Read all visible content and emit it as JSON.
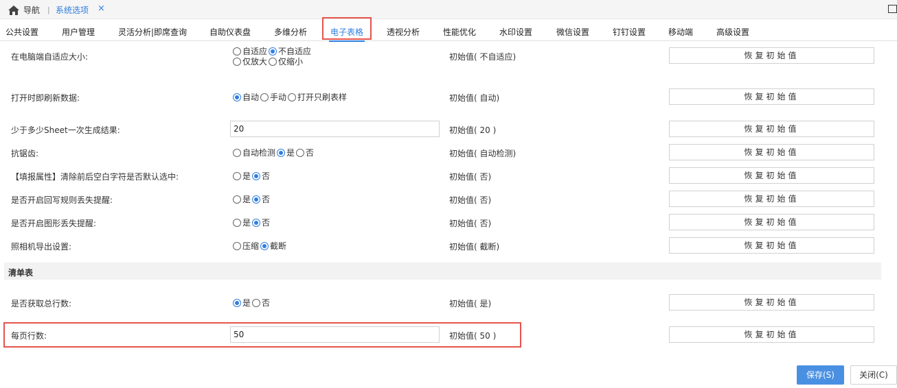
{
  "topbar": {
    "home_label": "导航",
    "separator": "|",
    "current_tab": "系统选项",
    "close_glyph": "×"
  },
  "tabs": [
    "公共设置",
    "用户管理",
    "灵活分析|即席查询",
    "自助仪表盘",
    "多维分析",
    "电子表格",
    "透视分析",
    "性能优化",
    "水印设置",
    "微信设置",
    "钉钉设置",
    "移动端",
    "高级设置"
  ],
  "active_tab": "电子表格",
  "restore_label": "恢复初始值",
  "rows": {
    "autofit": {
      "label": "在电脑端自适应大小:",
      "opt1": "自适应",
      "opt2": "不自适应",
      "opt3": "仅放大",
      "opt4": "仅缩小",
      "init": "初始值( 不自适应)"
    },
    "refresh": {
      "label": "打开时即刷新数据:",
      "opt1": "自动",
      "opt2": "手动",
      "opt3": "打开只刷表样",
      "init": "初始值( 自动)"
    },
    "sheet": {
      "label": "少于多少Sheet一次生成结果:",
      "value": "20",
      "init": "初始值( 20 )"
    },
    "antialias": {
      "label": "抗锯齿:",
      "opt1": "自动检测",
      "opt2": "是",
      "opt3": "否",
      "init": "初始值( 自动检测)"
    },
    "trim": {
      "label": "【填报属性】清除前后空白字符是否默认选中:",
      "opt1": "是",
      "opt2": "否",
      "init": "初始值( 否)"
    },
    "writeback": {
      "label": "是否开启回写规则丢失提醒:",
      "opt1": "是",
      "opt2": "否",
      "init": "初始值( 否)"
    },
    "graphic": {
      "label": "是否开启图形丢失提醒:",
      "opt1": "是",
      "opt2": "否",
      "init": "初始值( 否)"
    },
    "camera": {
      "label": "照相机导出设置:",
      "opt1": "压缩",
      "opt2": "截断",
      "init": "初始值( 截断)"
    }
  },
  "section_title": "清单表",
  "list_rows": {
    "total": {
      "label": "是否获取总行数:",
      "opt1": "是",
      "opt2": "否",
      "init": "初始值( 是)"
    },
    "perpage": {
      "label": "每页行数:",
      "value": "50",
      "init": "初始值( 50 )"
    }
  },
  "buttons": {
    "save": "保存(S)",
    "close": "关闭(C)"
  },
  "colors": {
    "accent": "#2f7ee0",
    "highlight": "#e5534b",
    "save_bg": "#4a90e2"
  }
}
